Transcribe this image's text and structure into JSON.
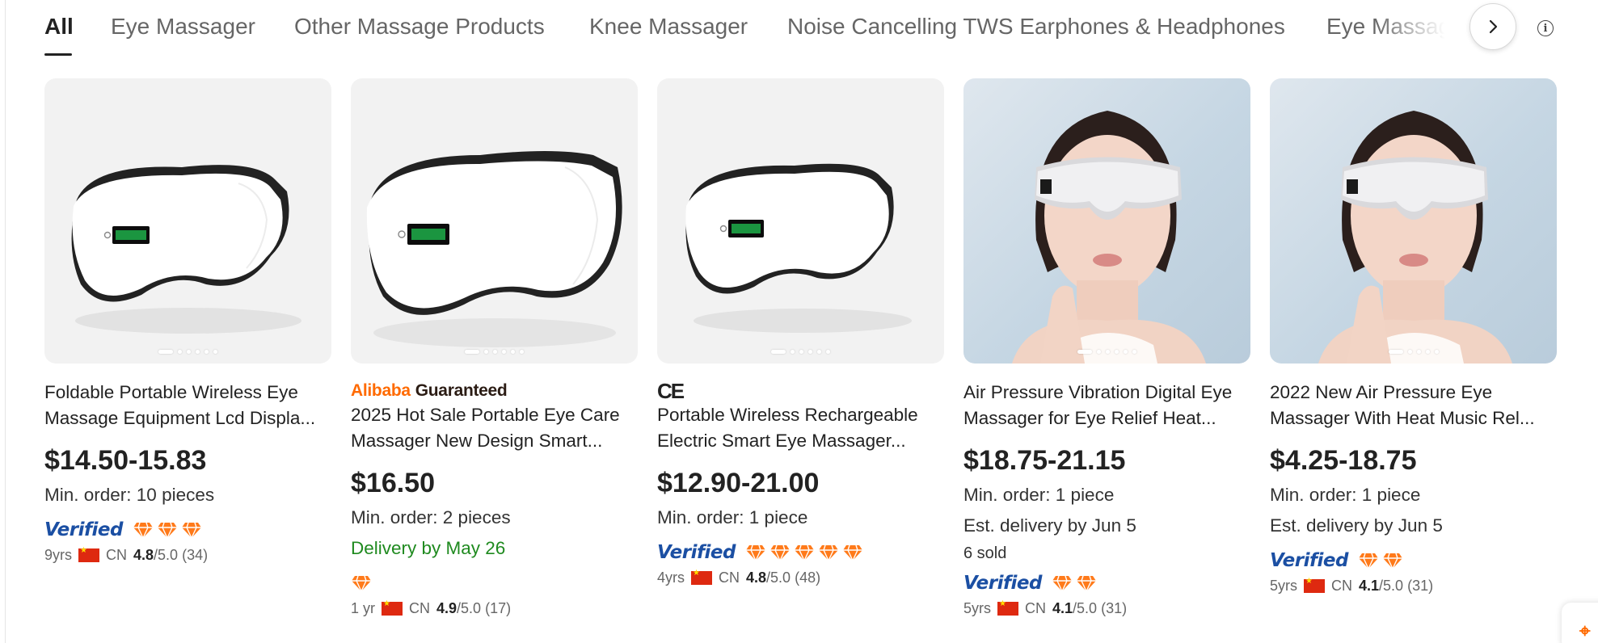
{
  "tabs": [
    "All",
    "Eye Massager",
    "Other Massage Products",
    "Knee Massager",
    "Noise Cancelling TWS Earphones & Headphones",
    "Eye Massage"
  ],
  "active_tab": 0,
  "colors": {
    "accent": "#ff6a00",
    "verified_blue": "#1b4fa3",
    "delivery_green": "#1f8a1f"
  },
  "icons": {
    "next": "chevron-right-icon",
    "info": "info-icon",
    "diamond": "diamond-icon"
  },
  "products": [
    {
      "title_line1": "Foldable Portable Wireless Eye",
      "title_line2": "Massage Equipment Lcd Displa...",
      "price": "$14.50-15.83",
      "min_order": "Min. order: 10 pieces",
      "verified": "Verified",
      "supplier_years": "9yrs",
      "country": "CN",
      "rating": "4.8",
      "rating_suffix": "/5.0 (34)"
    },
    {
      "badge_brand": "Alibaba",
      "badge_label": "Guaranteed",
      "title_line1": "2025 Hot Sale Portable Eye Care",
      "title_line2": "Massager New Design Smart...",
      "price": "$16.50",
      "min_order": "Min. order: 2 pieces",
      "delivery": "Delivery by May 26",
      "supplier_years": "1 yr",
      "country": "CN",
      "rating": "4.9",
      "rating_suffix": "/5.0 (17)"
    },
    {
      "badge_ce": "CE",
      "title_line1": "Portable Wireless Rechargeable",
      "title_line2": "Electric Smart Eye Massager...",
      "price": "$12.90-21.00",
      "min_order": "Min. order: 1 piece",
      "verified": "Verified",
      "supplier_years": "4yrs",
      "country": "CN",
      "rating": "4.8",
      "rating_suffix": "/5.0 (48)"
    },
    {
      "title_line1": "Air Pressure Vibration Digital Eye",
      "title_line2": "Massager for Eye Relief Heat...",
      "price": "$18.75-21.15",
      "min_order": "Min. order: 1 piece",
      "delivery": "Est. delivery by Jun 5",
      "sold": "6 sold",
      "verified": "Verified",
      "supplier_years": "5yrs",
      "country": "CN",
      "rating": "4.1",
      "rating_suffix": "/5.0 (31)"
    },
    {
      "title_line1": "2022 New Air Pressure Eye",
      "title_line2": "Massager With Heat Music Rel...",
      "price": "$4.25-18.75",
      "min_order": "Min. order: 1 piece",
      "delivery": "Est. delivery by Jun 5",
      "verified": "Verified",
      "supplier_years": "5yrs",
      "country": "CN",
      "rating": "4.1",
      "rating_suffix": "/5.0 (31)"
    }
  ]
}
